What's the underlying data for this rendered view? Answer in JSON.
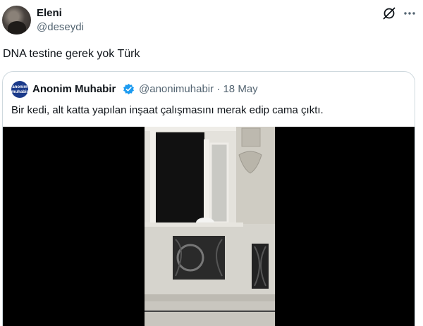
{
  "tweet": {
    "author": {
      "name": "Eleni",
      "handle": "@deseydi"
    },
    "text": "DNA testine gerek yok Türk",
    "actions": {
      "grok_icon": "grok-icon",
      "more_icon": "more-icon"
    }
  },
  "quoted_tweet": {
    "author": {
      "name": "Anonim Muhabir",
      "handle": "@anonimuhabir",
      "avatar_text": "anonim muhabir",
      "verified": true
    },
    "separator": "·",
    "date": "18 May",
    "text": "Bir kedi, alt katta yapılan inşaat çalışmasını merak edip cama çıktı.",
    "media": {
      "type": "video-frame",
      "background": "#000000"
    }
  },
  "colors": {
    "text": "#0f1419",
    "secondary": "#536471",
    "border": "#cfd9de",
    "verified": "#1d9bf0"
  }
}
